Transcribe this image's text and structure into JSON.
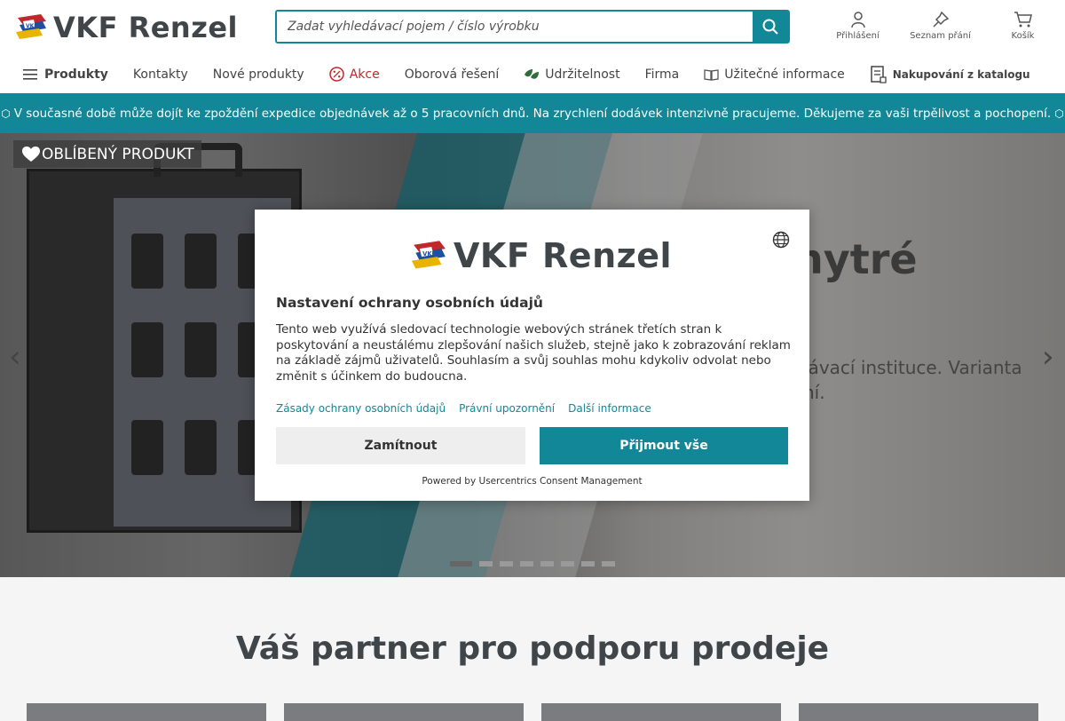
{
  "header": {
    "logo_text": "VKF Renzel",
    "search": {
      "placeholder": "Zadat vyhledávací pojem / číslo výrobku"
    },
    "icons": [
      {
        "label": "Přihlášení",
        "icon": "user-icon"
      },
      {
        "label": "Seznam přání",
        "icon": "pin-icon"
      },
      {
        "label": "Košík",
        "icon": "cart-icon"
      }
    ]
  },
  "nav": {
    "items": [
      {
        "label": "Produkty",
        "icon": "menu-icon"
      },
      {
        "label": "Kontakty"
      },
      {
        "label": "Nové produkty"
      },
      {
        "label": "Akce",
        "icon": "percent-icon"
      },
      {
        "label": "Oborová řešení"
      },
      {
        "label": "Udržitelnost",
        "icon": "leaf-icon"
      },
      {
        "label": "Firma"
      },
      {
        "label": "Užitečné informace",
        "icon": "book-icon"
      },
      {
        "label": "Nakupování z katalogu",
        "icon": "catalog-icon"
      }
    ]
  },
  "notice": {
    "text": "V současné době může dojít ke zpoždění expedice objednávek až o 5 pracovních dnů. Na zrychlení dodávek intenzivně pracujeme. Děkujeme za vaši trpělivost a pochopení."
  },
  "hero": {
    "badge": "OBLÍBENÝ PRODUKT",
    "title_partial": "hytré",
    "text_partial_1": "lávací instituce. Varianta",
    "text_partial_2": "ní.",
    "arrow_left": "‹",
    "arrow_right": "›",
    "slides_count": 8,
    "active_slide": 1
  },
  "section": {
    "title": "Váš partner pro podporu prodeje"
  },
  "consent": {
    "logo_text": "VKF Renzel",
    "title": "Nastavení ochrany osobních údajů",
    "body": "Tento web využívá sledovací technologie webových stránek třetích stran k poskytování a neustálému zlepšování našich služeb, stejně jako k zobrazování reklam na základě zájmů uživatelů. Souhlasím a svůj souhlas mohu kdykoliv odvolat nebo změnit s účinkem do budoucna.",
    "links": [
      "Zásady ochrany osobních údajů",
      "Právní upozornění",
      "Další informace"
    ],
    "deny_label": "Zamítnout",
    "accept_label": "Přijmout vše",
    "powered_by": "Powered by Usercentrics Consent Management"
  },
  "colors": {
    "accent": "#128797",
    "sale": "#c0282a",
    "green": "#2f6e3a",
    "text": "#3f4548"
  }
}
